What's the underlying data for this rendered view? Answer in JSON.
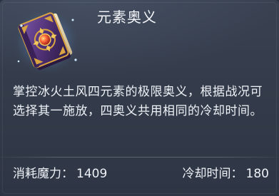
{
  "skill": {
    "title": "元素奥义",
    "icon": "spellbook-icon",
    "description": "掌控冰火土风四元素的极限奥义，根据战况可选择其一施放，四奥义共用相同的冷却时间。"
  },
  "stats": {
    "mana_label": "消耗魔力：",
    "mana_value": "1409",
    "cooldown_label": "冷却时间：",
    "cooldown_value": "180"
  },
  "colors": {
    "panel_bg": "#343c4b",
    "text": "#eef1f6",
    "book_cover": "#5a3a7a",
    "book_gold": "#d9a441",
    "gem": "#ff5a3a"
  }
}
